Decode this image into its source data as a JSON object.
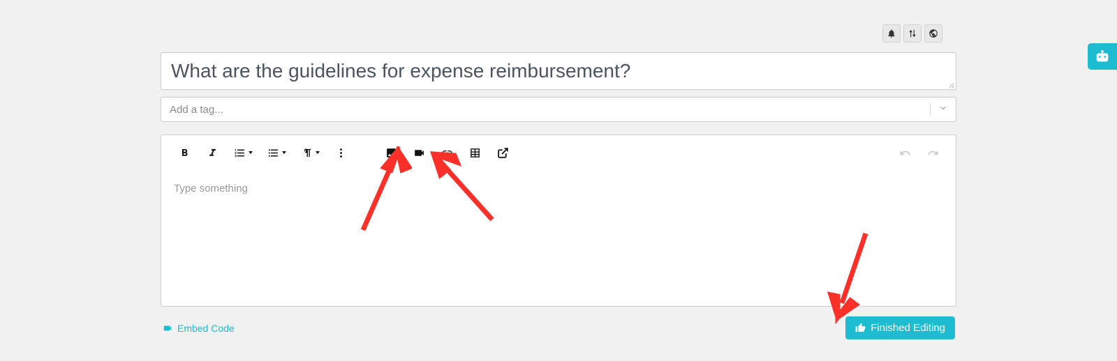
{
  "title": "What are the guidelines for expense reimbursement?",
  "tag_placeholder": "Add a tag...",
  "editor_placeholder": "Type something",
  "embed_code_label": "Embed Code",
  "finished_label": "Finished Editing",
  "top_icons": {
    "bell": "bell-icon",
    "sort": "sort-icon",
    "globe": "globe-icon"
  },
  "toolbar": {
    "bold": "B",
    "italic": "I"
  }
}
